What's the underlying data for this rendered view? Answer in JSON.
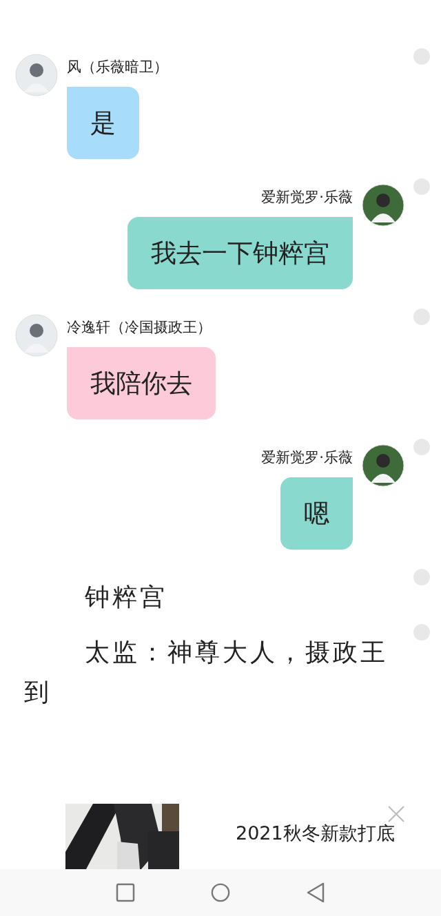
{
  "messages": [
    {
      "kind": "left",
      "name": "风（乐薇暗卫）",
      "text": "是",
      "color": "#a8dcfb"
    },
    {
      "kind": "right",
      "name": "爱新觉罗·乐薇",
      "text": "我去一下钟粹宫",
      "color": "#8ad9ce"
    },
    {
      "kind": "left",
      "name": "冷逸轩（冷国摄政王）",
      "text": "我陪你去",
      "color": "#fdcad9"
    },
    {
      "kind": "right",
      "name": "爱新觉罗·乐薇",
      "text": "嗯",
      "color": "#8ad9ce"
    },
    {
      "kind": "narration",
      "text": "钟粹宫"
    },
    {
      "kind": "narration",
      "text": "太监：神尊大人，摄政王到"
    }
  ],
  "ad": {
    "title": "2021秋冬新款打底"
  }
}
